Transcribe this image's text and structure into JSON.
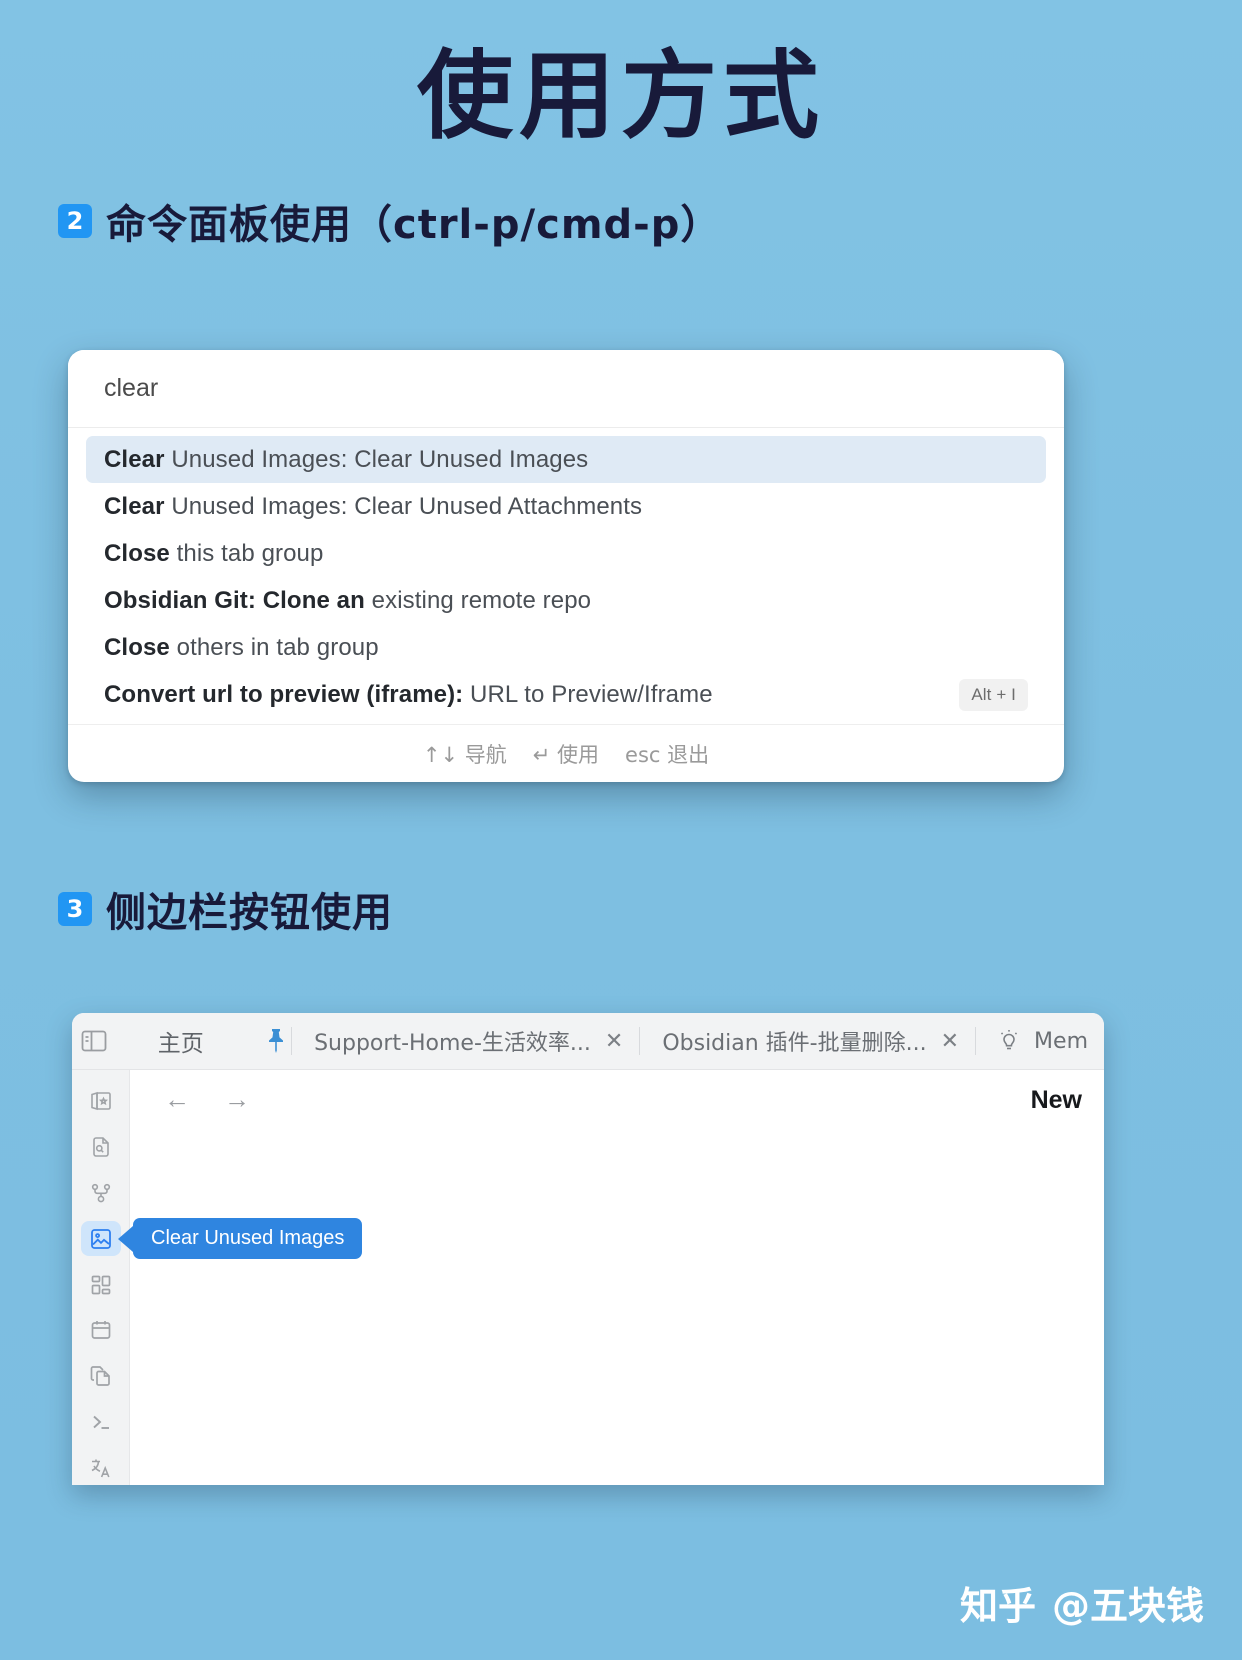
{
  "page": {
    "title": "使用方式",
    "background_color": "#7fc0e2",
    "title_color": "#181a3a",
    "accent_color": "#2196f3"
  },
  "sections": [
    {
      "number": "2",
      "title": "命令面板使用（ctrl-p/cmd-p）"
    },
    {
      "number": "3",
      "title": "侧边栏按钮使用"
    }
  ],
  "command_palette": {
    "query": "clear",
    "placeholder": "",
    "selected_index": 0,
    "items": [
      {
        "prefix": "Clear",
        "rest": " Unused Images: Clear Unused Images",
        "hotkey": ""
      },
      {
        "prefix": "Clear",
        "rest": " Unused Images: Clear Unused Attachments",
        "hotkey": ""
      },
      {
        "prefix": "Close",
        "rest": " this tab group",
        "hotkey": ""
      },
      {
        "prefix": "Obsidian Git: Clone an",
        "rest": " existing remote repo",
        "hotkey": ""
      },
      {
        "prefix": "Close",
        "rest": " others in tab group",
        "hotkey": ""
      },
      {
        "prefix": "Convert url to preview (iframe):",
        "rest": " URL to Preview/Iframe",
        "hotkey": "Alt + I"
      }
    ],
    "footer": {
      "navigate": "↑↓ 导航",
      "select": "↵ 使用",
      "dismiss": "esc 退出"
    }
  },
  "obsidian_window": {
    "sidebar_toggle_icon": "sidebar-toggle-icon",
    "home_tab_label": "主页",
    "pin_icon": "pin-icon",
    "tabs": [
      {
        "label": "Support-Home-生活效率...",
        "close": "✕",
        "icon": ""
      },
      {
        "label": "Obsidian 插件-批量删除...",
        "close": "✕",
        "icon": ""
      },
      {
        "label": "Mem",
        "close": "",
        "icon": "lightbulb-icon"
      }
    ],
    "ribbon_icons": [
      "sidebar-toggle-icon",
      "vault-cards-icon",
      "file-search-icon",
      "graph-view-icon",
      "image-icon",
      "apps-grid-icon",
      "calendar-icon",
      "copy-files-icon",
      "terminal-icon",
      "translate-icon"
    ],
    "active_ribbon_index": 4,
    "nav_back_icon": "arrow-left-icon",
    "nav_forward_icon": "arrow-right-icon",
    "new_label": "New",
    "tooltip": "Clear Unused Images"
  },
  "watermark": {
    "platform": "知乎",
    "handle": "@五块钱"
  }
}
